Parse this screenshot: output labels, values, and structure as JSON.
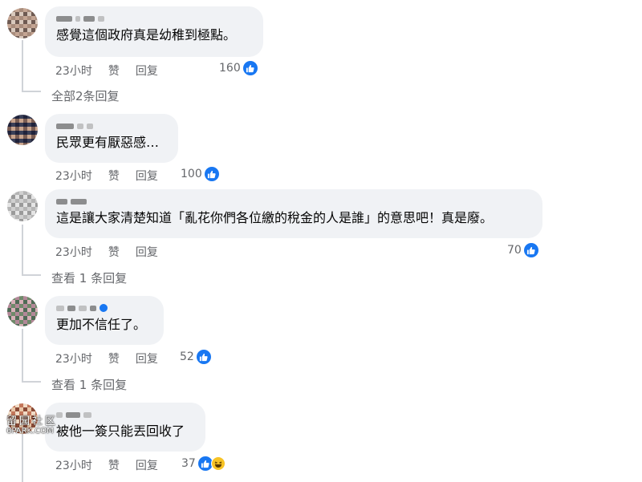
{
  "comments": [
    {
      "text": "感覺這個政府真是幼稚到極點。",
      "time": "23小时",
      "like_label": "赞",
      "reply_label": "回复",
      "reactions": "160",
      "view_replies": "全部2条回复"
    },
    {
      "text": "民眾更有厭惡感…",
      "time": "23小时",
      "like_label": "赞",
      "reply_label": "回复",
      "reactions": "100"
    },
    {
      "text": "這是讓大家清楚知道「亂花你們各位繳的稅金的人是誰」的意思吧！真是廢。",
      "time": "23小时",
      "like_label": "赞",
      "reply_label": "回复",
      "reactions": "70",
      "view_replies": "查看 1 条回复"
    },
    {
      "text": "更加不信任了。",
      "time": "23小时",
      "like_label": "赞",
      "reply_label": "回复",
      "reactions": "52",
      "view_replies": "查看 1 条回复"
    },
    {
      "text": "被他一簽只能丟回收了",
      "time": "23小时",
      "like_label": "赞",
      "reply_label": "回复",
      "reactions": "37"
    }
  ],
  "watermark": {
    "line1": "留园社区",
    "line2": "6PARK.COM"
  },
  "colors": {
    "bubble": "#f0f2f5",
    "meta": "#65676b",
    "like": "#1877f2"
  }
}
